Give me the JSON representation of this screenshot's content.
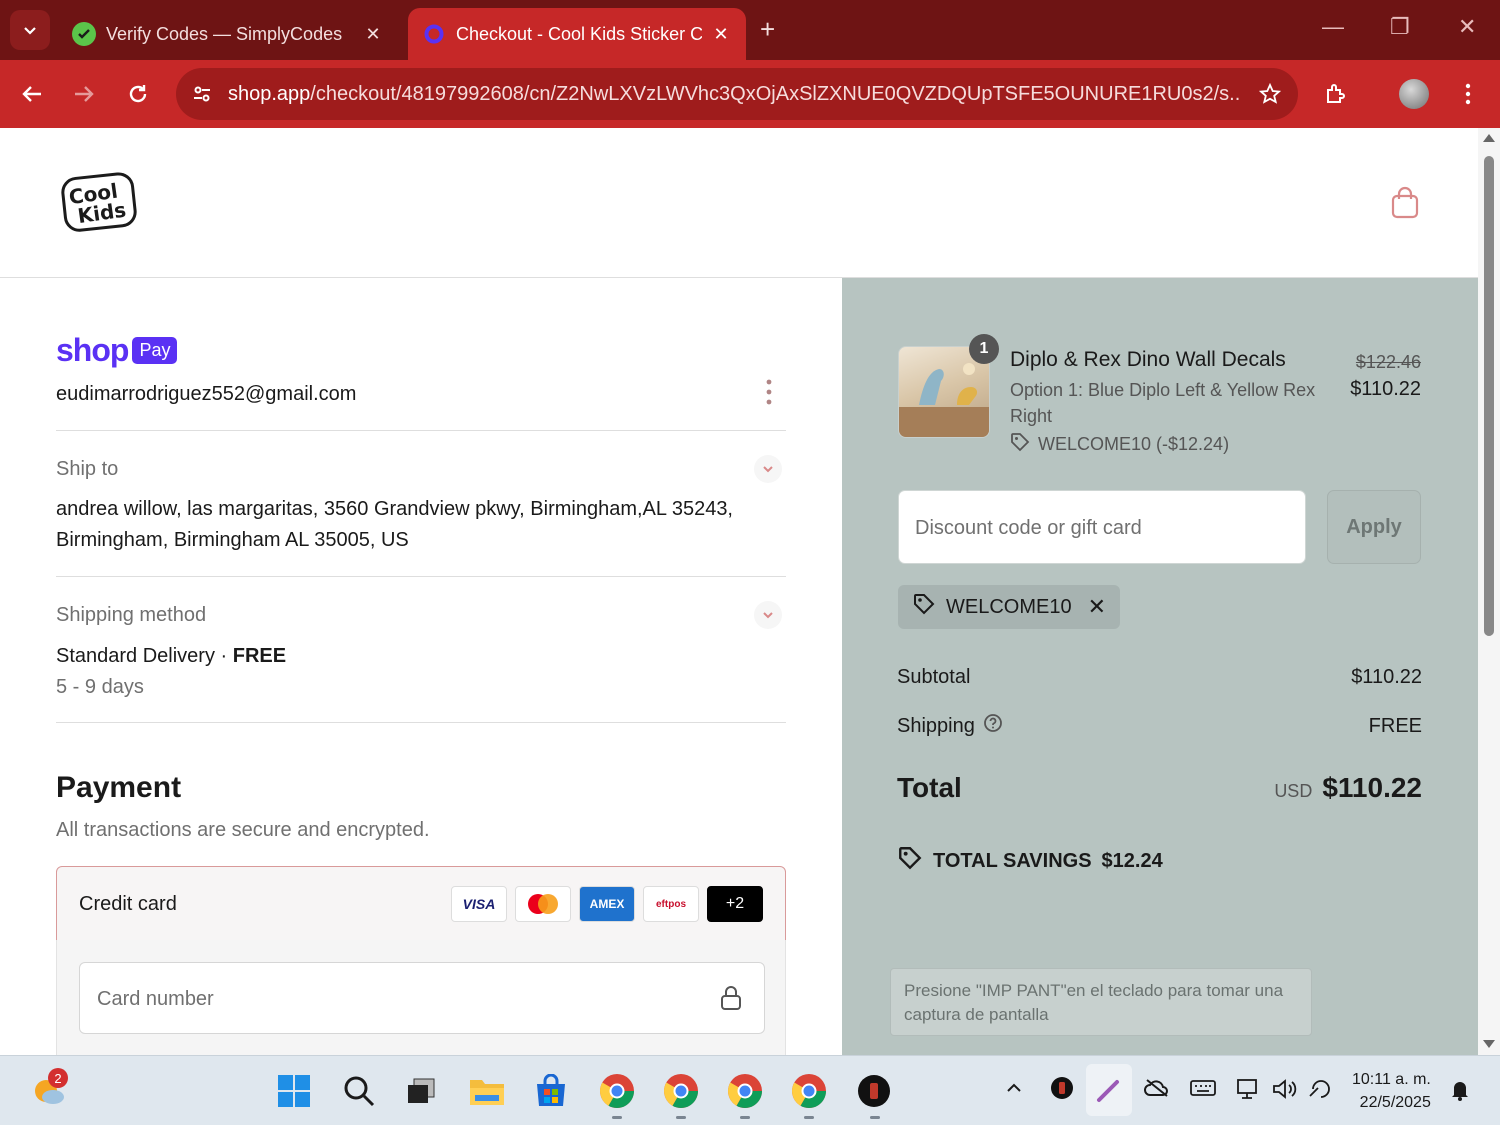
{
  "browser": {
    "tabs": [
      {
        "title": "Verify Codes — SimplyCodes",
        "active": false
      },
      {
        "title": "Checkout - Cool Kids Sticker Co",
        "active": true
      }
    ],
    "url_host": "shop.app",
    "url_path": "/checkout/48197992608/cn/Z2NwLXVzLWVhc3QxOjAxSlZXNUE0QVZDQUpTSFE5OUNURE1RU0s2/s...",
    "accent_color": "#c62828"
  },
  "store": {
    "logo_text": "Cool Kids Sticker Co"
  },
  "shop_pay": {
    "brand": "shop",
    "pay_badge": "Pay",
    "email": "eudimarrodriguez552@gmail.com"
  },
  "ship_to": {
    "label": "Ship to",
    "address_line1": "andrea willow, las margaritas, 3560 Grandview pkwy, Birmingham,AL 35243,",
    "address_line2": "Birmingham, Birmingham AL 35005, US"
  },
  "shipping_method": {
    "label": "Shipping method",
    "name": "Standard Delivery · ",
    "price": "FREE",
    "eta": "5 - 9 days"
  },
  "payment": {
    "title": "Payment",
    "subtitle": "All transactions are secure and encrypted.",
    "method_label": "Credit card",
    "card_brands": [
      "VISA",
      "MC",
      "AMEX",
      "eftpos",
      "+2"
    ],
    "card_number_placeholder": "Card number"
  },
  "order": {
    "item": {
      "quantity": "1",
      "title": "Diplo & Rex Dino Wall Decals",
      "variant": "Option 1: Blue Diplo Left & Yellow Rex Right",
      "discount": "WELCOME10 (-$12.24)",
      "original_price": "$122.46",
      "price": "$110.22"
    },
    "discount_placeholder": "Discount code or gift card",
    "apply_label": "Apply",
    "applied_code": "WELCOME10",
    "subtotal_label": "Subtotal",
    "subtotal": "$110.22",
    "shipping_label": "Shipping",
    "shipping": "FREE",
    "total_label": "Total",
    "currency": "USD",
    "total": "$110.22",
    "savings_label": "TOTAL SAVINGS",
    "savings": "$12.24",
    "print_hint": "Presione \"IMP PANT\"en el teclado para tomar una captura de pantalla"
  },
  "taskbar": {
    "weather_badge": "2",
    "time": "10:11 a. m.",
    "date": "22/5/2025"
  }
}
